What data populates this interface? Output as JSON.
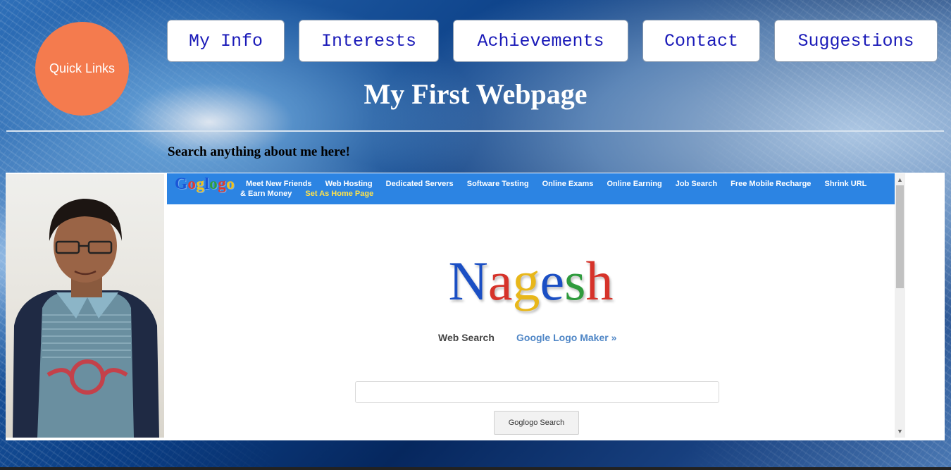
{
  "quick_links": "Quick Links",
  "nav": [
    "My Info",
    "Interests",
    "Achievements",
    "Contact",
    "Suggestions"
  ],
  "page_title": "My First Webpage",
  "search_caption": "Search anything about me here!",
  "embedded": {
    "logo": [
      "G",
      "o",
      "g",
      "l",
      "o",
      "g",
      "o"
    ],
    "logo_colors": [
      "#1a56d6",
      "#e03a2f",
      "#f2c21b",
      "#1a56d6",
      "#2e9e3e",
      "#e03a2f",
      "#f2c21b"
    ],
    "links": [
      "Meet New Friends",
      "Web Hosting",
      "Dedicated Servers",
      "Software Testing",
      "Online Exams",
      "Online Earning",
      "Job Search",
      "Free Mobile Recharge",
      "Shrink URL & Earn Money"
    ],
    "home_link": "Set As Home Page",
    "brand_letters": [
      "N",
      "a",
      "g",
      "e",
      "s",
      "h"
    ],
    "brand_colors": [
      "#1b4fc4",
      "#d6332a",
      "#e8b71a",
      "#1b4fc4",
      "#2f9b3d",
      "#d6332a"
    ],
    "web_search": "Web Search",
    "logo_maker": "Google Logo Maker »",
    "search_button": "Goglogo Search",
    "search_value": ""
  },
  "colors": {
    "quick_links_bg": "#f47b4e",
    "nav_text": "#1a1ab8",
    "bar_blue": "#2c84e3",
    "link_highlight": "#ffe34a"
  }
}
